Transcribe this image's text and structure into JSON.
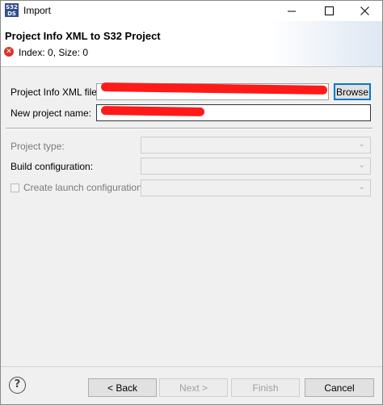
{
  "window": {
    "title": "Import",
    "icon_text": "S32\nDS",
    "controls": {
      "minimize": "minimize",
      "maximize": "maximize",
      "close": "close"
    }
  },
  "header": {
    "title": "Project Info XML to S32 Project",
    "error_message": "Index: 0, Size: 0",
    "error_icon": "error-icon"
  },
  "form": {
    "xml_file_label": "Project Info XML file:",
    "xml_file_value": "",
    "browse_label": "Browse",
    "project_name_label": "New project name:",
    "project_name_value": "",
    "project_type_label": "Project type:",
    "project_type_value": "",
    "build_config_label": "Build configuration:",
    "build_config_value": "",
    "launch_config_label": "Create launch configuration",
    "launch_config_checked": false,
    "launch_config_value": ""
  },
  "footer": {
    "help_icon": "help-icon",
    "back_label": "< Back",
    "next_label": "Next >",
    "finish_label": "Finish",
    "cancel_label": "Cancel"
  },
  "colors": {
    "redaction": "#ff1a1a",
    "focus_border": "#0078d7",
    "error": "#d9342b"
  }
}
